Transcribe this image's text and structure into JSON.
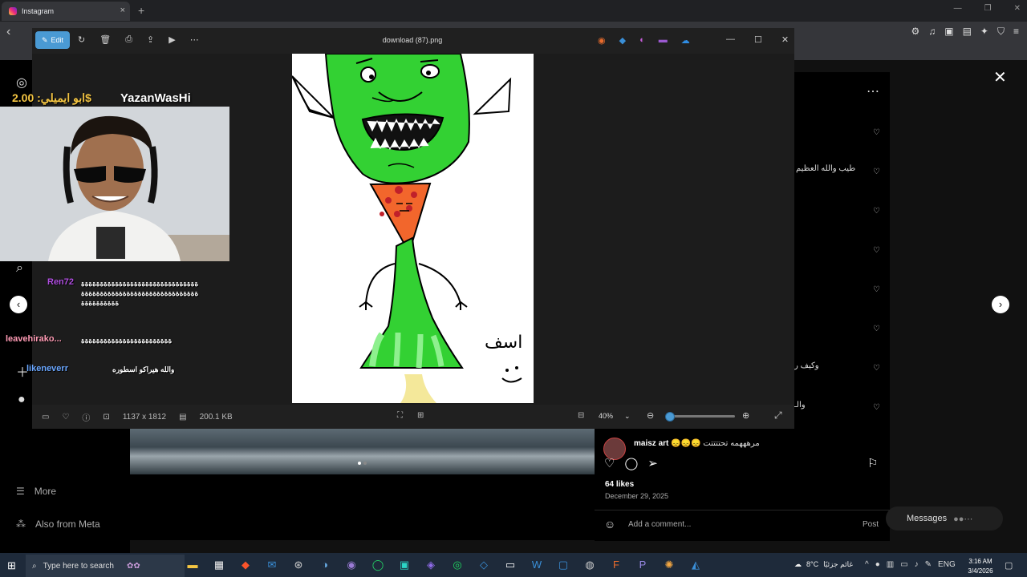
{
  "browser": {
    "tab_title": "Instagram",
    "tab_close": "×",
    "new_tab": "+",
    "win_min": "—",
    "win_max": "❐",
    "win_close": "✕"
  },
  "instagram": {
    "more_label": "More",
    "meta_label": "Also from Meta",
    "comments": [
      {
        "text": "طيب والله العظيم"
      },
      {
        "text": "وكيف ر"
      },
      {
        "text": "والـ"
      }
    ],
    "comment_user": "maisz art",
    "comment_text": "😞😞😞 مرهههمه تحتتتتت",
    "likes": "64 likes",
    "date": "December 29, 2025",
    "add_comment_placeholder": "Add a comment...",
    "post_label": "Post",
    "messages_label": "Messages"
  },
  "viewer": {
    "edit_label": "Edit",
    "title": "download (87).png",
    "dimensions": "1137 x 1812",
    "filesize": "200.1 KB",
    "zoom": "40%",
    "zoom_fraction": 0.05
  },
  "stream": {
    "donor_text": "ابو ايميلي: 2.00$",
    "streamer_name": "YazanWasHi",
    "chat": [
      {
        "name": "Ren72",
        "color": "#b04ee0",
        "msg": "ةةةةةةةةةةةةةةةةةةةةةةةةةةةةةةةةةةةةةةةةةةةةةةةةةةةةةةةةةةةةةةةةةةةةةةةة"
      },
      {
        "name": "leavehirako...",
        "color": "#ff9bb5",
        "msg": "ةةةةةةةةةةةةةةةةةةةةةةةة"
      },
      {
        "name": "likeneverr",
        "color": "#6aa7ff",
        "msg": "والله هيراكو اسطوره"
      }
    ]
  },
  "taskbar": {
    "search_placeholder": "Type here to search",
    "weather": "8°C",
    "weather_text": "غائم جزئيًا",
    "lang": "ENG",
    "time": "3:16 AM",
    "date": "3/4/2026"
  },
  "drawing": {
    "signature": "اسف"
  }
}
